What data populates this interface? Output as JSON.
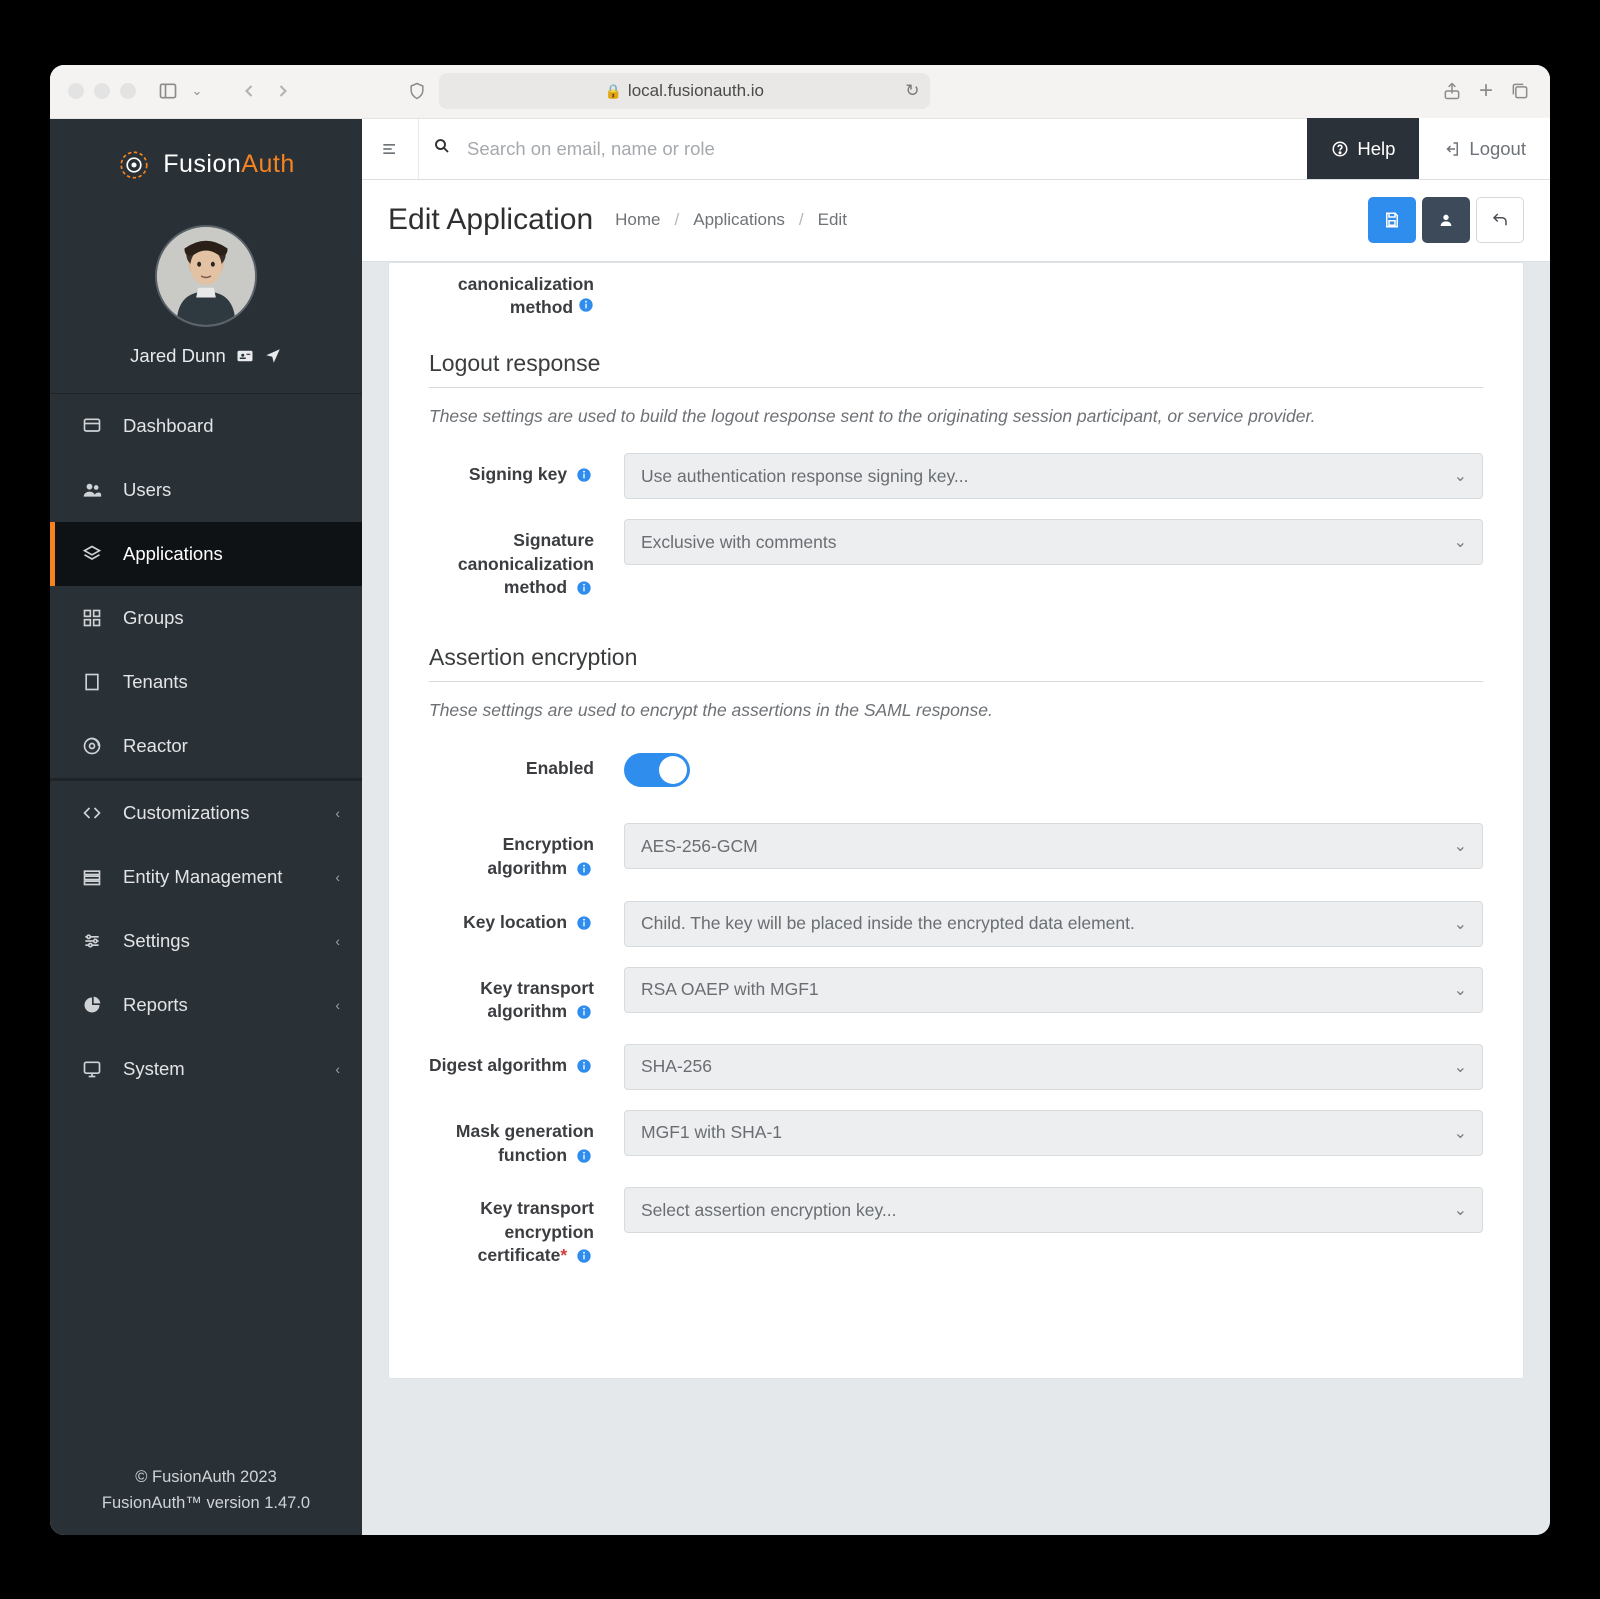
{
  "browser": {
    "url": "local.fusionauth.io"
  },
  "brand": {
    "name_a": "Fusion",
    "name_b": "Auth"
  },
  "profile": {
    "name": "Jared Dunn"
  },
  "nav": {
    "items": [
      {
        "label": "Dashboard"
      },
      {
        "label": "Users"
      },
      {
        "label": "Applications"
      },
      {
        "label": "Groups"
      },
      {
        "label": "Tenants"
      },
      {
        "label": "Reactor"
      }
    ],
    "expandable": [
      {
        "label": "Customizations"
      },
      {
        "label": "Entity Management"
      },
      {
        "label": "Settings"
      },
      {
        "label": "Reports"
      },
      {
        "label": "System"
      }
    ]
  },
  "footer": {
    "line1": "© FusionAuth 2023",
    "line2": "FusionAuth™ version 1.47.0"
  },
  "topbar": {
    "search_placeholder": "Search on email, name or role",
    "help": "Help",
    "logout": "Logout"
  },
  "page": {
    "title": "Edit Application",
    "breadcrumb": {
      "home": "Home",
      "apps": "Applications",
      "current": "Edit"
    }
  },
  "form": {
    "prior_label": "canonicalization method",
    "logout": {
      "heading": "Logout response",
      "desc": "These settings are used to build the logout response sent to the originating session participant, or service provider.",
      "signing_key_label": "Signing key",
      "signing_key_value": "Use authentication response signing key...",
      "canon_label": "Signature canonicalization method",
      "canon_value": "Exclusive with comments"
    },
    "assertion": {
      "heading": "Assertion encryption",
      "desc": "These settings are used to encrypt the assertions in the SAML response.",
      "enabled_label": "Enabled",
      "enc_alg_label": "Encryption algorithm",
      "enc_alg_value": "AES-256-GCM",
      "key_loc_label": "Key location",
      "key_loc_value": "Child. The key will be placed inside the encrypted data element.",
      "key_trans_label": "Key transport algorithm",
      "key_trans_value": "RSA OAEP with MGF1",
      "digest_label": "Digest algorithm",
      "digest_value": "SHA-256",
      "mask_label": "Mask generation function",
      "mask_value": "MGF1 with SHA-1",
      "cert_label": "Key transport encryption certificate",
      "cert_value": "Select assertion encryption key..."
    }
  }
}
